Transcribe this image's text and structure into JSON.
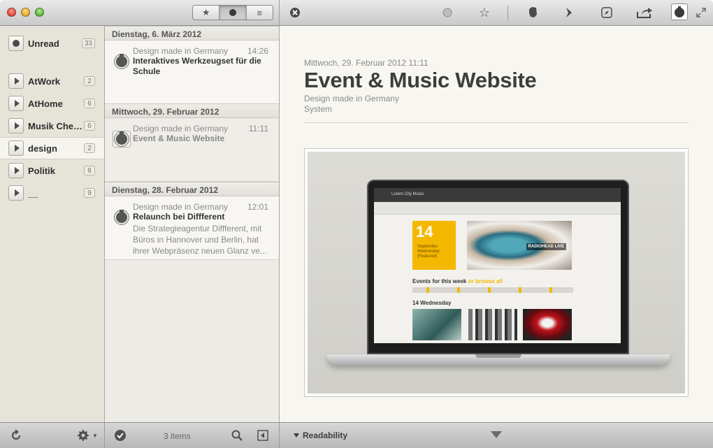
{
  "sidebar": {
    "items": [
      {
        "label": "Unread",
        "count": "33"
      },
      {
        "label": "AtWork",
        "count": "2"
      },
      {
        "label": "AtHome",
        "count": "6"
      },
      {
        "label": "Musik Checker",
        "count": "6"
      },
      {
        "label": "design",
        "count": "2"
      },
      {
        "label": "Politik",
        "count": "8"
      },
      {
        "label": "__",
        "count": "9"
      }
    ]
  },
  "list": {
    "days": [
      {
        "label": "Dienstag, 6. März 2012"
      },
      {
        "label": "Mittwoch, 29. Februar 2012"
      },
      {
        "label": "Dienstag, 28. Februar 2012"
      }
    ],
    "articles": [
      {
        "source": "Design made in Germany",
        "time": "14:26",
        "title": "Interaktives Werkzeugset für die Schule",
        "snippet": ""
      },
      {
        "source": "Design made in Germany",
        "time": "11:11",
        "title": "Event & Music Website",
        "snippet": ""
      },
      {
        "source": "Design made in Germany",
        "time": "12:01",
        "title": "Relaunch bei Diffferent",
        "snippet": "Die Strategieagentur Diffferent, mit Büros in Hannover und Berlin, hat ihrer Webpräsenz neuen Glanz ve..."
      }
    ]
  },
  "content": {
    "date": "Mittwoch, 29. Februar 2012 11:11",
    "title": "Event & Music Website",
    "feed": "Design made in Germany",
    "folder": "System",
    "image": {
      "site_name": "Lorem City Music",
      "date_number": "14",
      "date_lines": [
        "September",
        "Wednesday",
        "(Featured)"
      ],
      "photo_tag": "RADIOHEAD LIVE",
      "events_heading": "Events for this week",
      "events_suffix": "or browse all",
      "sub_heading": "14 Wednesday"
    }
  },
  "bottom": {
    "items_count": "3 items",
    "readability_label": "Readability"
  },
  "toolbar": {
    "filter_options": [
      "starred",
      "unread",
      "all"
    ],
    "selected_filter": "unread"
  }
}
